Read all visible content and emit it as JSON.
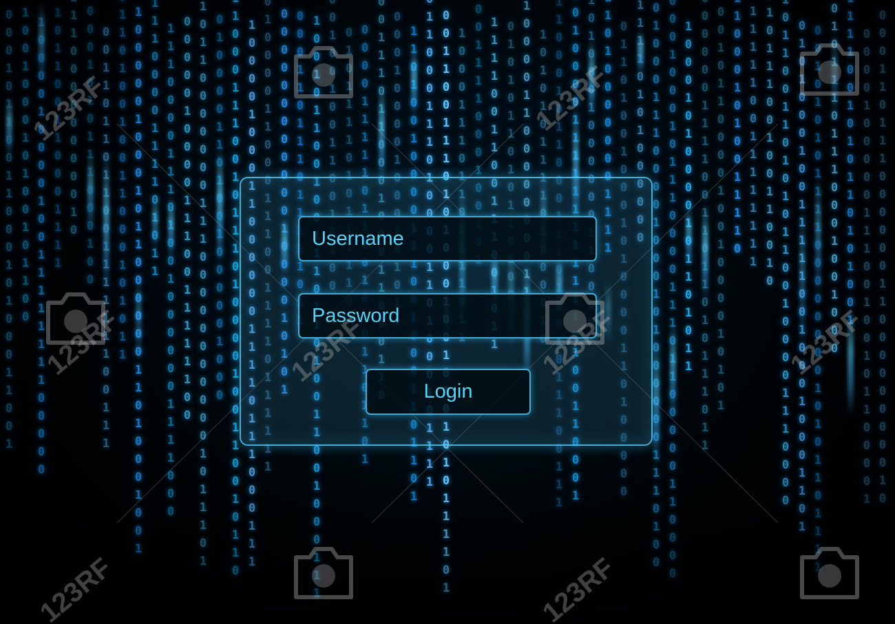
{
  "login_form": {
    "username_placeholder": "Username",
    "password_placeholder": "Password",
    "login_label": "Login"
  },
  "watermark": {
    "text": "123RF"
  },
  "colors": {
    "accent": "#5ad2f5",
    "rain": "#2fa8e6",
    "background": "#000000"
  }
}
